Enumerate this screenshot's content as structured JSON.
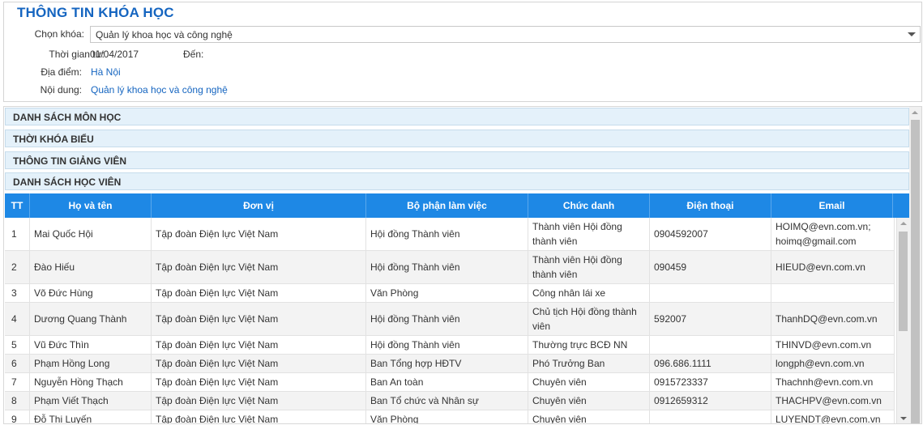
{
  "course_info": {
    "title": "THÔNG TIN KHÓA HỌC",
    "select_label": "Chọn khóa:",
    "selected_course": "Quản lý khoa học và công nghệ",
    "time_from_label": "Thời gian từ:",
    "time_from_value": "01/04/2017",
    "time_to_label": "Đến:",
    "time_to_value": "",
    "location_label": "Địa điểm:",
    "location_value": "Hà Nội",
    "content_label": "Nội dung:",
    "content_value": "Quản lý khoa học và công nghệ"
  },
  "sections": [
    {
      "label": "DANH SÁCH MÔN HỌC"
    },
    {
      "label": "THỜI KHÓA BIỂU"
    },
    {
      "label": "THÔNG TIN GIẢNG VIÊN"
    },
    {
      "label": "DANH SÁCH HỌC VIÊN"
    }
  ],
  "table": {
    "columns": [
      "TT",
      "Họ và tên",
      "Đơn vị",
      "Bộ phận làm việc",
      "Chức danh",
      "Điện thoại",
      "Email"
    ],
    "rows": [
      [
        "1",
        "Mai Quốc Hội",
        "Tập đoàn Điện lực Việt Nam",
        "Hội đồng Thành viên",
        "Thành viên Hội đồng thành viên",
        "0904592007",
        "HOIMQ@evn.com.vn; hoimq@gmail.com"
      ],
      [
        "2",
        "Đào Hiếu",
        "Tập đoàn Điện lực Việt Nam",
        "Hội đồng Thành viên",
        "Thành viên Hội đồng thành viên",
        "090459",
        "HIEUD@evn.com.vn"
      ],
      [
        "3",
        "Võ Đức Hùng",
        "Tập đoàn Điện lực Việt Nam",
        "Văn Phòng",
        "Công nhân lái xe",
        "",
        ""
      ],
      [
        "4",
        "Dương Quang Thành",
        "Tập đoàn Điện lực Việt Nam",
        "Hội đồng Thành viên",
        "Chủ tịch Hội đồng thành viên",
        "592007",
        "ThanhDQ@evn.com.vn"
      ],
      [
        "5",
        "Vũ Đức Thìn",
        "Tập đoàn Điện lực Việt Nam",
        "Hội đồng Thành viên",
        "Thường trực BCĐ NN",
        "",
        "THINVD@evn.com.vn"
      ],
      [
        "6",
        "Phạm Hồng Long",
        "Tập đoàn Điện lực Việt Nam",
        "Ban Tổng hợp HĐTV",
        "Phó Trưởng Ban",
        "096.686.1111",
        "longph@evn.com.vn"
      ],
      [
        "7",
        "Nguyễn Hồng Thạch",
        "Tập đoàn Điện lực Việt Nam",
        "Ban An toàn",
        "Chuyên viên",
        "0915723337",
        "Thachnh@evn.com.vn"
      ],
      [
        "8",
        "Phạm Viết Thạch",
        "Tập đoàn Điện lực Việt Nam",
        "Ban Tổ chức và Nhân sự",
        "Chuyên viên",
        "0912659312",
        "THACHPV@evn.com.vn"
      ],
      [
        "9",
        "Đỗ Thị Luyến",
        "Tập đoàn Điện lực Việt Nam",
        "Văn Phòng",
        "Chuyên viên",
        "",
        "LUYENDT@evn.com.vn"
      ]
    ]
  }
}
